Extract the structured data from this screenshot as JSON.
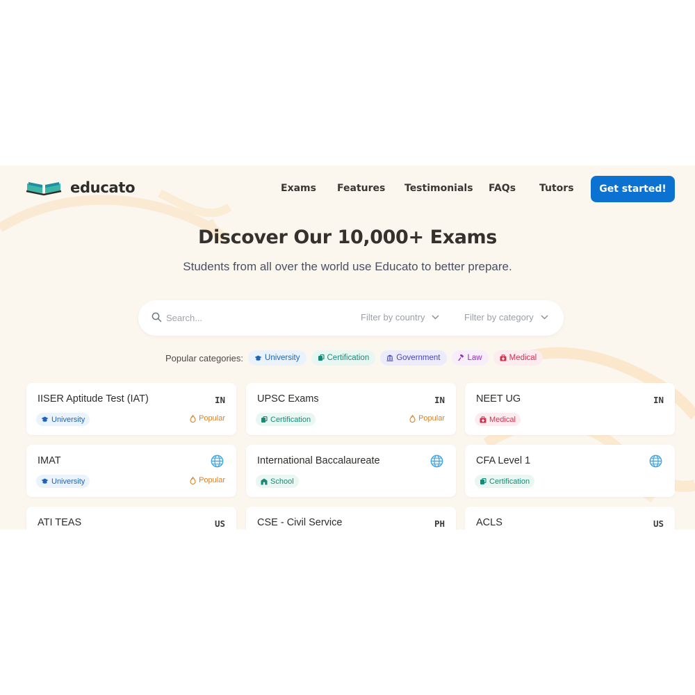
{
  "brand": {
    "name": "educato"
  },
  "nav": {
    "links": [
      "Exams",
      "Features",
      "Testimonials",
      "FAQs",
      "Tutors"
    ],
    "cta": "Get started!"
  },
  "hero": {
    "title": "Discover Our 10,000+ Exams",
    "subtitle": "Students from all over the world use Educato to better prepare."
  },
  "search": {
    "placeholder": "Search...",
    "country_filter": "Filter by country",
    "category_filter": "Filter by category"
  },
  "popular": {
    "label": "Popular categories:",
    "chips": [
      {
        "label": "University",
        "icon": "graduation-cap-icon",
        "color": "#1e63b8"
      },
      {
        "label": "Certification",
        "icon": "certificate-icon",
        "color": "#178a76"
      },
      {
        "label": "Government",
        "icon": "government-building-icon",
        "color": "#4a44b5"
      },
      {
        "label": "Law",
        "icon": "gavel-icon",
        "color": "#9330b8"
      },
      {
        "label": "Medical",
        "icon": "medical-kit-icon",
        "color": "#d1334f"
      }
    ]
  },
  "popular_marker": "Popular",
  "exams": [
    {
      "title": "IISER Aptitude Test (IAT)",
      "country": "IN",
      "tag": "University",
      "popular": true
    },
    {
      "title": "UPSC Exams",
      "country": "IN",
      "tag": "Certification",
      "popular": true
    },
    {
      "title": "NEET UG",
      "country": "IN",
      "tag": "Medical",
      "popular": false
    },
    {
      "title": "IMAT",
      "country": "globe",
      "tag": "University",
      "popular": true
    },
    {
      "title": "International Baccalaureate",
      "country": "globe",
      "tag": "School",
      "popular": false
    },
    {
      "title": "CFA Level 1",
      "country": "globe",
      "tag": "Certification",
      "popular": false
    },
    {
      "title": "ATI TEAS",
      "country": "US",
      "tag": "",
      "popular": false
    },
    {
      "title": "CSE - Civil Service",
      "country": "PH",
      "tag": "",
      "popular": false
    },
    {
      "title": "ACLS",
      "country": "US",
      "tag": "",
      "popular": false
    }
  ]
}
